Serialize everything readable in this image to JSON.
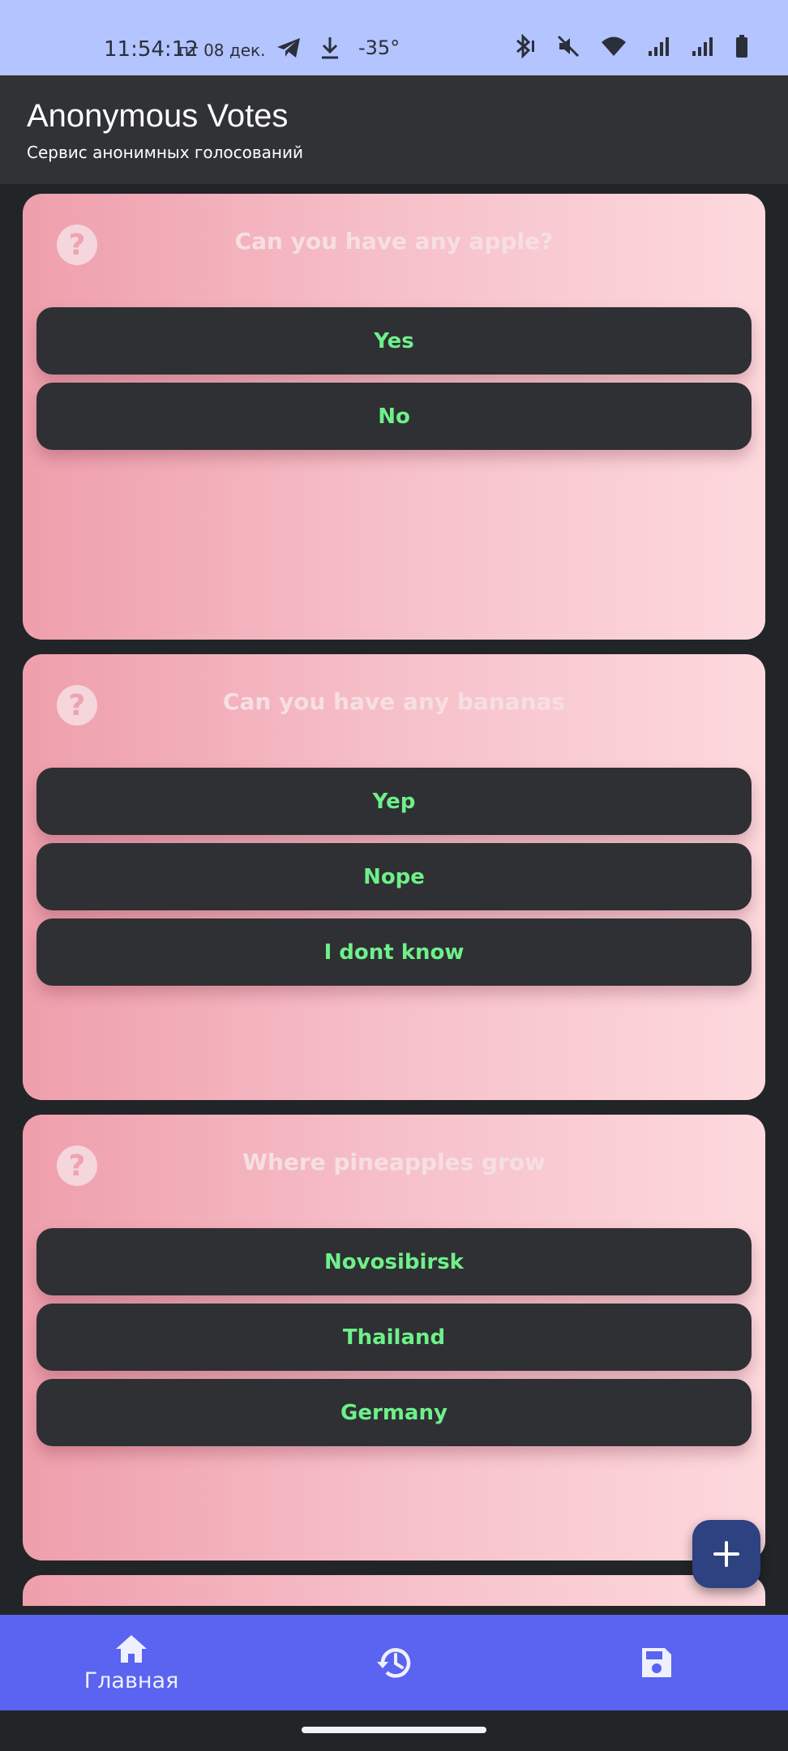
{
  "status_bar": {
    "time": "11:54:12",
    "date": "пт 08 дек.",
    "temperature": "-35°",
    "icons_left": [
      "telegram-icon",
      "download-icon"
    ],
    "icons_right": [
      "bluetooth-icon",
      "mute-icon",
      "wifi-icon",
      "signal-icon",
      "signal-icon-2",
      "battery-icon"
    ]
  },
  "app_bar": {
    "title": "Anonymous Votes",
    "subtitle": "Сервис анонимных голосований"
  },
  "polls": [
    {
      "question": "Can you have any apple?",
      "options": [
        "Yes",
        "No"
      ]
    },
    {
      "question": "Can you have any bananas",
      "options": [
        "Yep",
        "Nope",
        "I dont know"
      ]
    },
    {
      "question": "Where pineapples grow",
      "options": [
        "Novosibirsk",
        "Thailand",
        "Germany"
      ]
    }
  ],
  "fab": {
    "icon": "plus-icon"
  },
  "bottom_nav": {
    "items": [
      {
        "icon": "home-icon",
        "label": "Главная",
        "active": true
      },
      {
        "icon": "history-icon",
        "label": ""
      },
      {
        "icon": "save-icon",
        "label": ""
      }
    ]
  },
  "colors": {
    "status_bar": "#b3c4ff",
    "app_bar": "#303236",
    "background": "#222528",
    "card_gradient_start": "#ef9fac",
    "card_gradient_end": "#fdd9de",
    "option_bg": "#2f3033",
    "option_text": "#6ef08a",
    "nav_bg": "#5a64f0",
    "fab_bg": "#2e4180"
  }
}
